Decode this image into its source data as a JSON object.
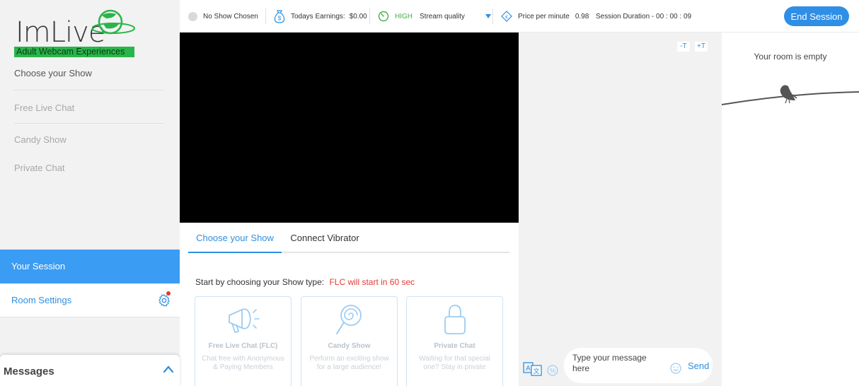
{
  "logo": {
    "wordmark": "ImLive",
    "tagline": "Adult Webcam Experiences"
  },
  "sidebar": {
    "heading": "Choose your Show",
    "shows": [
      "Free Live Chat",
      "Candy Show",
      "Private Chat"
    ],
    "your_session": "Your Session",
    "room_settings": "Room Settings",
    "messages": "Messages"
  },
  "topbar": {
    "show_status": "No Show Chosen",
    "earnings_label": "Todays Earnings:",
    "earnings_value": "$0.00",
    "quality_level": "HIGH",
    "quality_label": "Stream quality",
    "price_label": "Price per minute",
    "price_value": "0.98",
    "session_duration": "Session Duration - 00 : 00 : 09",
    "end_session": "End Session"
  },
  "show_panel": {
    "tabs": [
      "Choose your Show",
      "Connect Vibrator"
    ],
    "start_text": "Start by choosing your Show type:",
    "countdown": "FLC will start in 60 sec",
    "cards": [
      {
        "title": "Free Live Chat (FLC)",
        "desc": "Chat free with Anonymous & Paying Members"
      },
      {
        "title": "Candy Show",
        "desc": "Perform an exciting show for a large audience!"
      },
      {
        "title": "Private Chat",
        "desc": "Waiting for that special one? Stay in private"
      }
    ]
  },
  "chat": {
    "font_decrease": "-T",
    "font_increase": "+T",
    "input_placeholder": "Type your message here",
    "send": "Send"
  },
  "room": {
    "empty_text": "Your room is empty"
  },
  "colors": {
    "accent": "#2f8fe6",
    "logo_green": "#2ab54a",
    "countdown_red": "#e53935",
    "quality_green": "#3fb24a"
  }
}
